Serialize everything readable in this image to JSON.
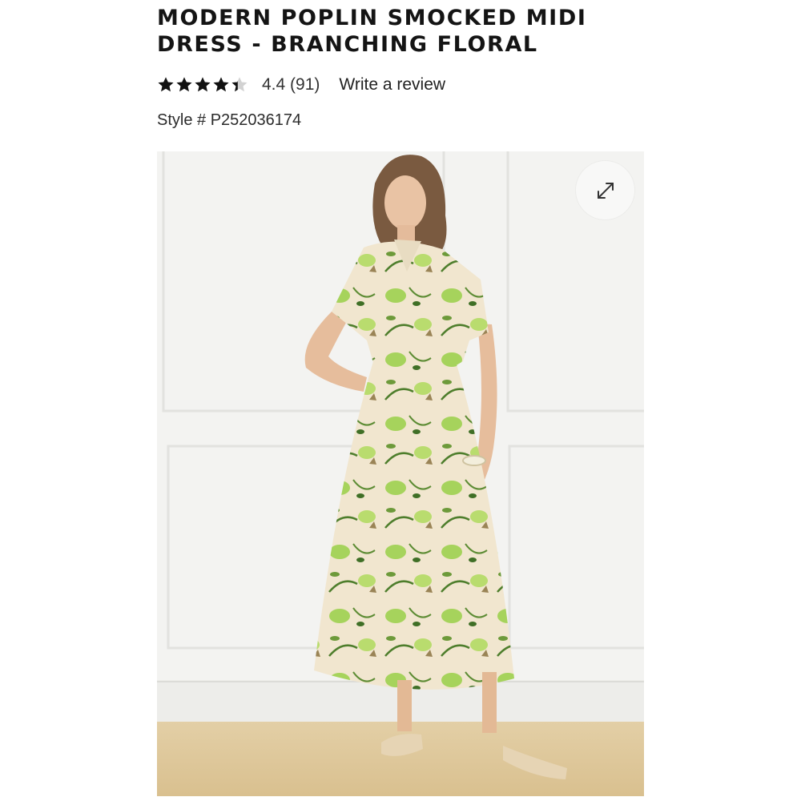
{
  "product": {
    "title": "MODERN POPLIN SMOCKED MIDI DRESS - BRANCHING FLORAL",
    "rating": 4.4,
    "rating_max": 5,
    "rating_text": "4.4",
    "review_count_text": "(91)",
    "write_review_label": "Write a review",
    "style_label": "Style # P252036174"
  },
  "gallery": {
    "image_alt": "Model wearing the Modern Poplin Smocked Midi Dress in Branching Floral",
    "expand_icon": "expand-arrows-icon"
  },
  "colors": {
    "star": "#111111",
    "star_empty": "#d2d2d2",
    "title": "#141414",
    "print_green": "#8bbf4a",
    "print_dark_green": "#4e7e2c",
    "dress_base": "#f1e6cf"
  }
}
